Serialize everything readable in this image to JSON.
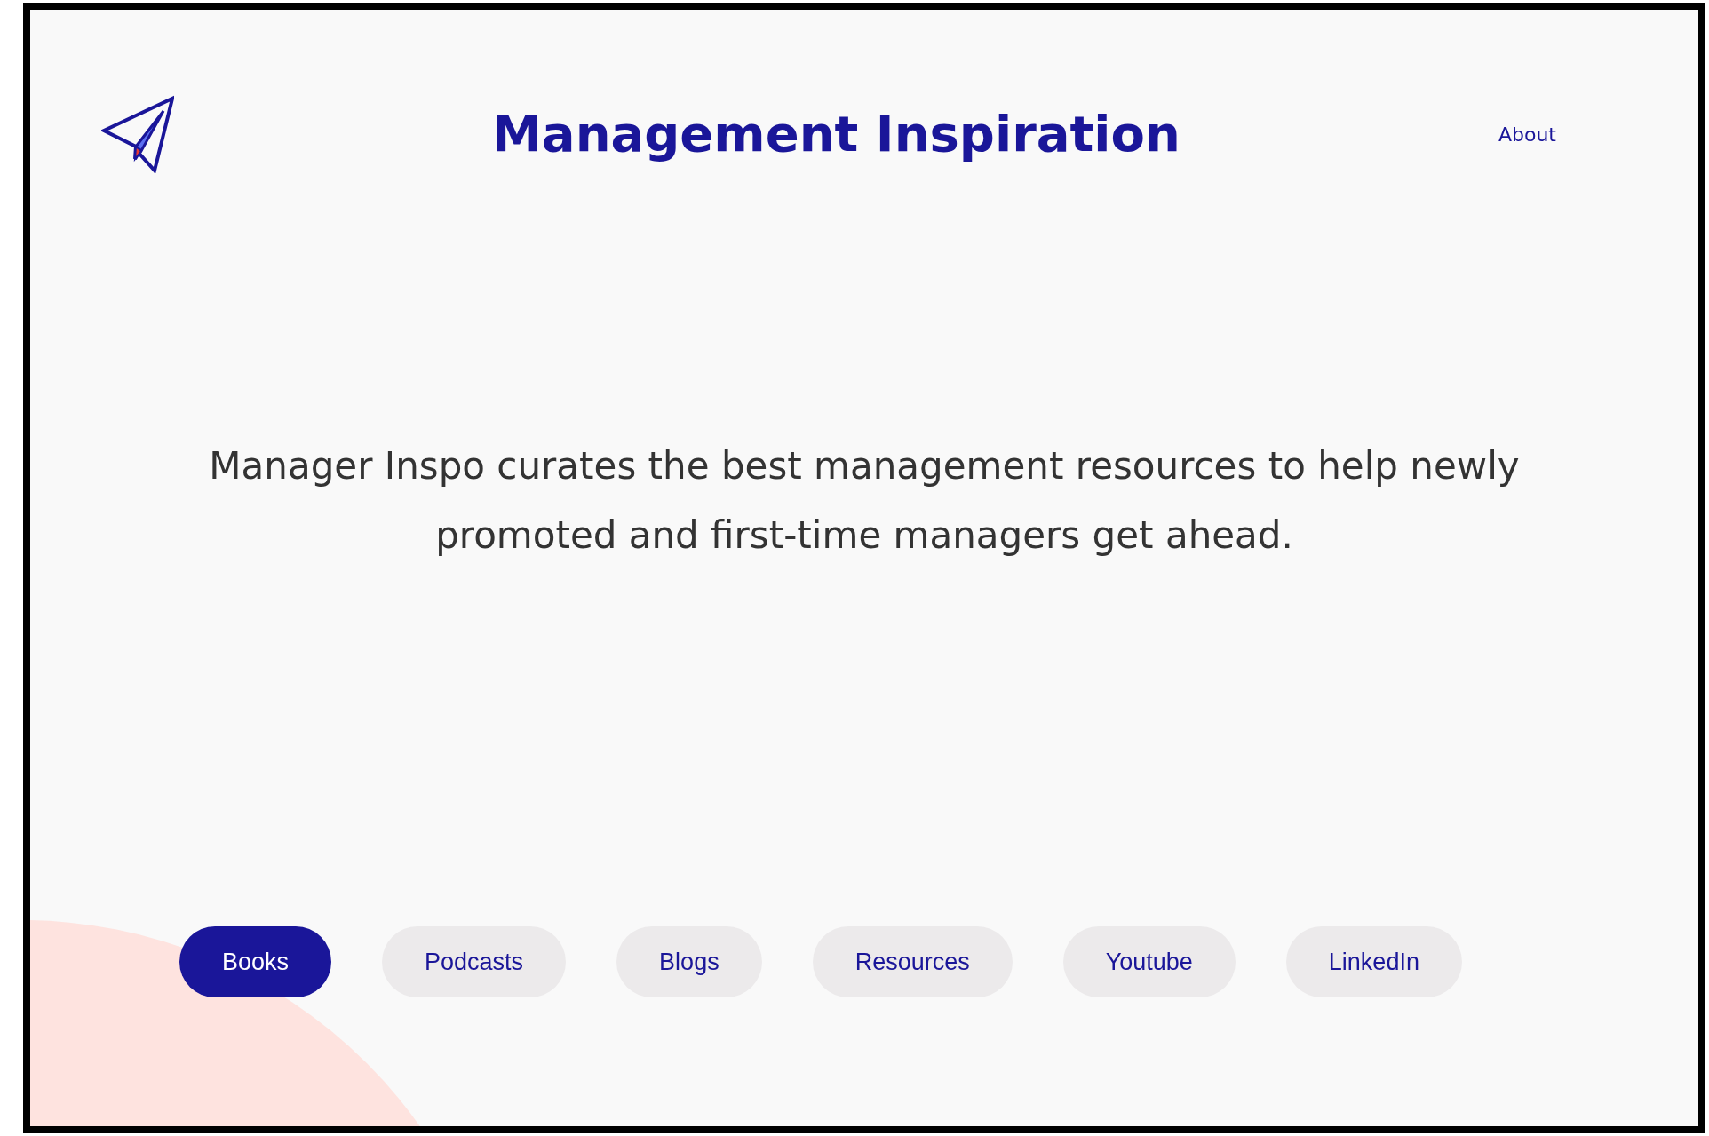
{
  "header": {
    "title": "Management Inspiration",
    "nav": [
      {
        "label": "About"
      }
    ]
  },
  "tagline": "Manager Inspo curates the best management resources to help newly promoted and first-time managers get ahead.",
  "categories": [
    {
      "label": "Books",
      "selected": true
    },
    {
      "label": "Podcasts",
      "selected": false
    },
    {
      "label": "Blogs",
      "selected": false
    },
    {
      "label": "Resources",
      "selected": false
    },
    {
      "label": "Youtube",
      "selected": false
    },
    {
      "label": "LinkedIn",
      "selected": false
    }
  ]
}
